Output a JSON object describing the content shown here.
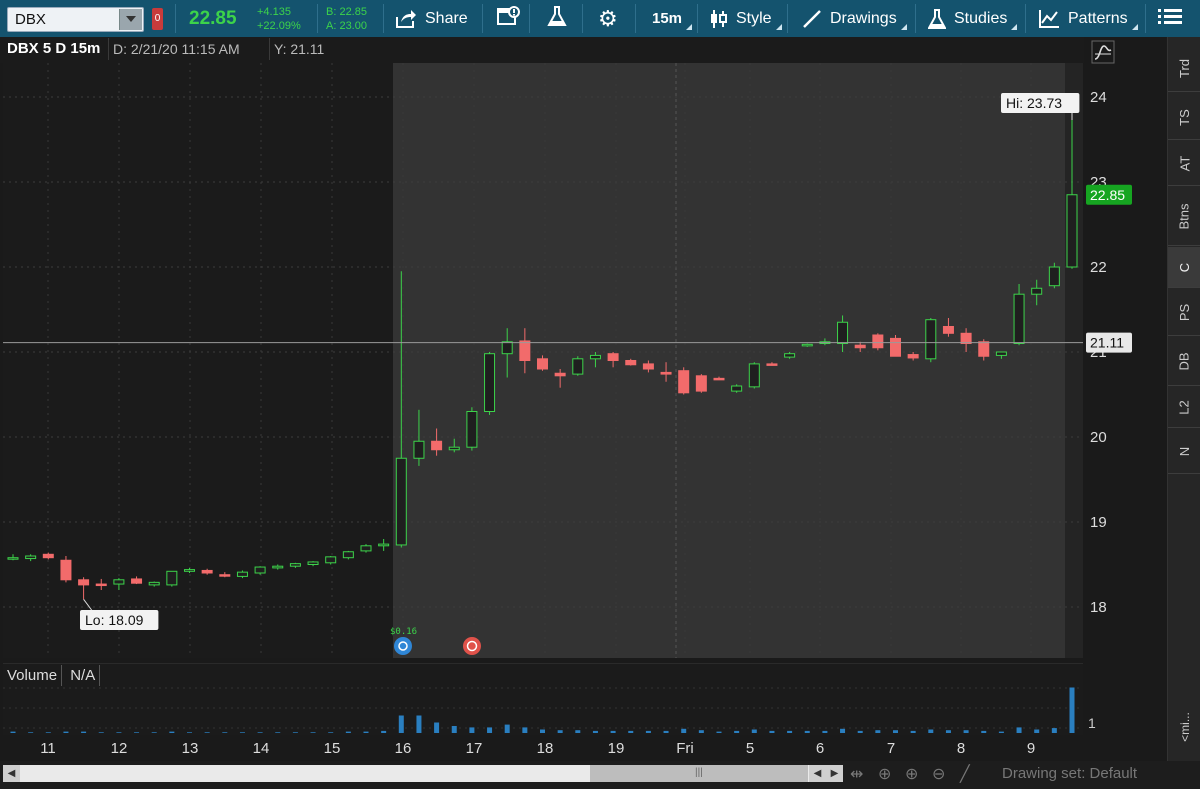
{
  "toolbar": {
    "symbol": "DBX",
    "link_tag": "0",
    "last_price": "22.85",
    "change_abs": "+4.135",
    "change_pct": "+22.09%",
    "bid": "B: 22.85",
    "ask": "A: 23.00",
    "share_label": "Share",
    "timeframe_label": "15m",
    "style_label": "Style",
    "drawings_label": "Drawings",
    "studies_label": "Studies",
    "patterns_label": "Patterns"
  },
  "chart_header": {
    "title": "DBX 5 D 15m",
    "date": "D: 2/21/20 11:15 AM",
    "y": "Y: 21.11"
  },
  "price_axis": {
    "ticks": [
      "24",
      "23",
      "22",
      "21",
      "20",
      "19",
      "18"
    ],
    "cursor_label": "21.11",
    "last_label": "22.85",
    "hi_label": "Hi: 23.73",
    "lo_label": "Lo: 18.09"
  },
  "events": {
    "dividend_label": "$0.16"
  },
  "volume": {
    "title": "Volume",
    "value": "N/A",
    "axis_label": "1"
  },
  "time_axis": [
    "11",
    "12",
    "13",
    "14",
    "15",
    "16",
    "17",
    "18",
    "19",
    "Fri",
    "5",
    "6",
    "7",
    "8",
    "9"
  ],
  "right_panel": {
    "tabs": [
      "Trd",
      "TS",
      "AT",
      "Btns",
      "C",
      "PS",
      "DB",
      "L2",
      "N"
    ],
    "collapse_label": "<mi..."
  },
  "bottom_bar": {
    "drawing_set": "Drawing set: Default"
  },
  "colors": {
    "up": "#3cd34a",
    "down": "#f26b6b",
    "toolbar_bg": "#14536e",
    "premarket_shade": "#1b1b1b",
    "session_bg": "#333333"
  },
  "chart_data": {
    "type": "candlestick",
    "ylim": [
      17.4,
      24.4
    ],
    "y_ticks": [
      18,
      19,
      20,
      21,
      22,
      23,
      24
    ],
    "crosshair_y": 21.11,
    "series": [
      {
        "o": 18.58,
        "h": 18.62,
        "l": 18.55,
        "c": 18.58
      },
      {
        "o": 18.57,
        "h": 18.62,
        "l": 18.54,
        "c": 18.6
      },
      {
        "o": 18.62,
        "h": 18.64,
        "l": 18.56,
        "c": 18.58
      },
      {
        "o": 18.55,
        "h": 18.6,
        "l": 18.29,
        "c": 18.32
      },
      {
        "o": 18.32,
        "h": 18.35,
        "l": 18.09,
        "c": 18.26
      },
      {
        "o": 18.27,
        "h": 18.33,
        "l": 18.2,
        "c": 18.26
      },
      {
        "o": 18.27,
        "h": 18.34,
        "l": 18.2,
        "c": 18.32
      },
      {
        "o": 18.33,
        "h": 18.36,
        "l": 18.27,
        "c": 18.28
      },
      {
        "o": 18.26,
        "h": 18.3,
        "l": 18.24,
        "c": 18.29
      },
      {
        "o": 18.26,
        "h": 18.42,
        "l": 18.24,
        "c": 18.42
      },
      {
        "o": 18.42,
        "h": 18.46,
        "l": 18.4,
        "c": 18.44
      },
      {
        "o": 18.43,
        "h": 18.45,
        "l": 18.38,
        "c": 18.4
      },
      {
        "o": 18.38,
        "h": 18.41,
        "l": 18.35,
        "c": 18.37
      },
      {
        "o": 18.36,
        "h": 18.43,
        "l": 18.34,
        "c": 18.41
      },
      {
        "o": 18.4,
        "h": 18.48,
        "l": 18.38,
        "c": 18.47
      },
      {
        "o": 18.46,
        "h": 18.5,
        "l": 18.44,
        "c": 18.48
      },
      {
        "o": 18.48,
        "h": 18.52,
        "l": 18.46,
        "c": 18.51
      },
      {
        "o": 18.5,
        "h": 18.54,
        "l": 18.48,
        "c": 18.53
      },
      {
        "o": 18.52,
        "h": 18.6,
        "l": 18.5,
        "c": 18.59
      },
      {
        "o": 18.58,
        "h": 18.66,
        "l": 18.56,
        "c": 18.65
      },
      {
        "o": 18.66,
        "h": 18.74,
        "l": 18.64,
        "c": 18.72
      },
      {
        "o": 18.72,
        "h": 18.8,
        "l": 18.66,
        "c": 18.74
      },
      {
        "o": 18.73,
        "h": 21.95,
        "l": 18.7,
        "c": 19.75
      },
      {
        "o": 19.75,
        "h": 20.32,
        "l": 19.66,
        "c": 19.95
      },
      {
        "o": 19.95,
        "h": 20.1,
        "l": 19.78,
        "c": 19.85
      },
      {
        "o": 19.85,
        "h": 19.98,
        "l": 19.82,
        "c": 19.88
      },
      {
        "o": 19.88,
        "h": 20.35,
        "l": 19.84,
        "c": 20.3
      },
      {
        "o": 20.3,
        "h": 21.0,
        "l": 20.26,
        "c": 20.98
      },
      {
        "o": 20.98,
        "h": 21.28,
        "l": 20.7,
        "c": 21.12
      },
      {
        "o": 21.13,
        "h": 21.28,
        "l": 20.75,
        "c": 20.9
      },
      {
        "o": 20.92,
        "h": 20.96,
        "l": 20.78,
        "c": 20.8
      },
      {
        "o": 20.75,
        "h": 20.8,
        "l": 20.58,
        "c": 20.72
      },
      {
        "o": 20.74,
        "h": 20.95,
        "l": 20.72,
        "c": 20.92
      },
      {
        "o": 20.92,
        "h": 21.0,
        "l": 20.82,
        "c": 20.96
      },
      {
        "o": 20.98,
        "h": 21.0,
        "l": 20.82,
        "c": 20.9
      },
      {
        "o": 20.9,
        "h": 20.92,
        "l": 20.84,
        "c": 20.85
      },
      {
        "o": 20.86,
        "h": 20.9,
        "l": 20.76,
        "c": 20.8
      },
      {
        "o": 20.76,
        "h": 20.88,
        "l": 20.65,
        "c": 20.74
      },
      {
        "o": 20.78,
        "h": 20.82,
        "l": 20.5,
        "c": 20.52
      },
      {
        "o": 20.72,
        "h": 20.74,
        "l": 20.52,
        "c": 20.54
      },
      {
        "o": 20.69,
        "h": 20.71,
        "l": 20.67,
        "c": 20.68
      },
      {
        "o": 20.54,
        "h": 20.62,
        "l": 20.52,
        "c": 20.6
      },
      {
        "o": 20.59,
        "h": 20.88,
        "l": 20.57,
        "c": 20.86
      },
      {
        "o": 20.86,
        "h": 20.88,
        "l": 20.84,
        "c": 20.85
      },
      {
        "o": 20.94,
        "h": 21.0,
        "l": 20.92,
        "c": 20.98
      },
      {
        "o": 21.08,
        "h": 21.1,
        "l": 21.06,
        "c": 21.09
      },
      {
        "o": 21.1,
        "h": 21.16,
        "l": 21.08,
        "c": 21.12
      },
      {
        "o": 21.1,
        "h": 21.43,
        "l": 21.0,
        "c": 21.35
      },
      {
        "o": 21.08,
        "h": 21.12,
        "l": 21.0,
        "c": 21.05
      },
      {
        "o": 21.2,
        "h": 21.22,
        "l": 21.02,
        "c": 21.05
      },
      {
        "o": 21.16,
        "h": 21.2,
        "l": 20.95,
        "c": 20.95
      },
      {
        "o": 20.97,
        "h": 21.0,
        "l": 20.9,
        "c": 20.93
      },
      {
        "o": 20.92,
        "h": 21.4,
        "l": 20.88,
        "c": 21.38
      },
      {
        "o": 21.3,
        "h": 21.4,
        "l": 21.18,
        "c": 21.22
      },
      {
        "o": 21.22,
        "h": 21.28,
        "l": 21.0,
        "c": 21.1
      },
      {
        "o": 21.12,
        "h": 21.15,
        "l": 20.9,
        "c": 20.95
      },
      {
        "o": 20.96,
        "h": 21.0,
        "l": 20.92,
        "c": 21.0
      },
      {
        "o": 21.1,
        "h": 21.8,
        "l": 21.08,
        "c": 21.68
      },
      {
        "o": 21.68,
        "h": 21.85,
        "l": 21.55,
        "c": 21.75
      },
      {
        "o": 21.78,
        "h": 22.05,
        "l": 21.75,
        "c": 22.0
      },
      {
        "o": 22.0,
        "h": 23.73,
        "l": 21.98,
        "c": 22.85
      }
    ],
    "volume_bars": [
      0.02,
      0.01,
      0.01,
      0.02,
      0.02,
      0.01,
      0.01,
      0.01,
      0.01,
      0.02,
      0.01,
      0.01,
      0.01,
      0.01,
      0.01,
      0.01,
      0.01,
      0.01,
      0.01,
      0.02,
      0.02,
      0.03,
      0.25,
      0.25,
      0.15,
      0.1,
      0.08,
      0.08,
      0.12,
      0.08,
      0.05,
      0.04,
      0.04,
      0.03,
      0.03,
      0.03,
      0.03,
      0.03,
      0.06,
      0.04,
      0.02,
      0.03,
      0.05,
      0.03,
      0.03,
      0.03,
      0.03,
      0.06,
      0.03,
      0.04,
      0.04,
      0.03,
      0.05,
      0.04,
      0.04,
      0.03,
      0.02,
      0.08,
      0.05,
      0.07,
      0.65
    ]
  }
}
